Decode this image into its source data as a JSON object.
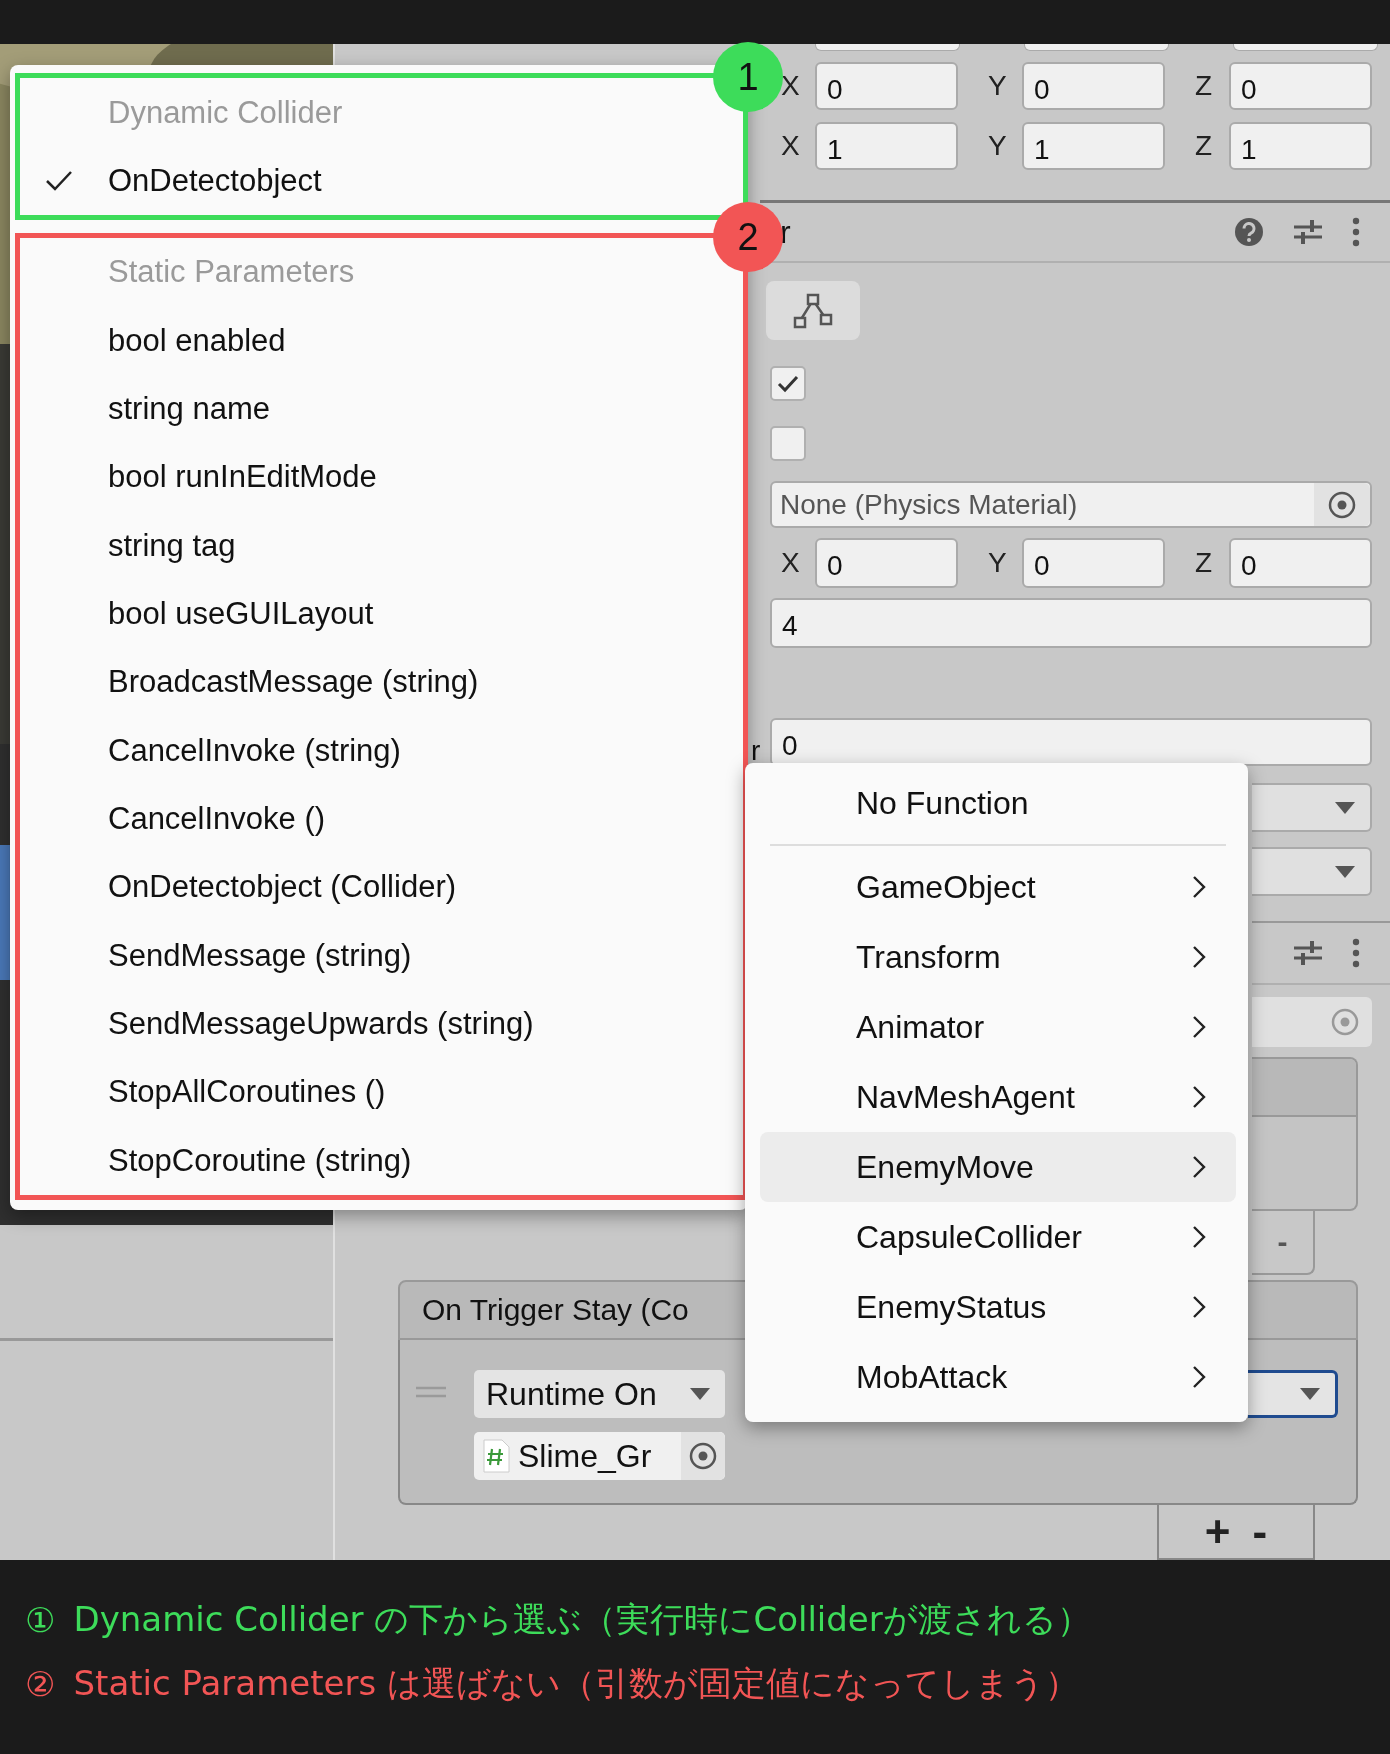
{
  "transform_rows": [
    {
      "fields": [
        {
          "axis": "X",
          "value": "0"
        },
        {
          "axis": "Y",
          "value": "0"
        },
        {
          "axis": "Z",
          "value": "0"
        }
      ]
    },
    {
      "fields": [
        {
          "axis": "X",
          "value": "1"
        },
        {
          "axis": "Y",
          "value": "1"
        },
        {
          "axis": "Z",
          "value": "1"
        }
      ]
    }
  ],
  "component": {
    "title": "r"
  },
  "toggles": [
    {
      "checked": true
    },
    {
      "checked": false
    }
  ],
  "material_field": {
    "value": "None (Physics Material)"
  },
  "center_row": {
    "fields": [
      {
        "axis": "X",
        "value": "0"
      },
      {
        "axis": "Y",
        "value": "0"
      },
      {
        "axis": "Z",
        "value": "0"
      }
    ]
  },
  "radius_field": {
    "value": "4"
  },
  "layer_field": {
    "label": "r",
    "value": "0"
  },
  "event_list": {
    "remove_button": "-"
  },
  "trigger_event": {
    "title": "On Trigger Stay (Co",
    "call_dropdown": "Runtime On",
    "target_field": "Slime_Gr",
    "add_button": "+",
    "remove_button": "-"
  },
  "function_menu": {
    "groups": [
      {
        "annotation": "1",
        "color": "#3ddc5a",
        "items": [
          {
            "kind": "header",
            "label": "Dynamic Collider"
          },
          {
            "kind": "option",
            "label": "OnDetectobject",
            "checked": true
          }
        ]
      },
      {
        "annotation": "2",
        "color": "#f25555",
        "items": [
          {
            "kind": "header",
            "label": "Static Parameters"
          },
          {
            "kind": "option",
            "label": "bool enabled",
            "checked": false
          },
          {
            "kind": "option",
            "label": "string name",
            "checked": false
          },
          {
            "kind": "option",
            "label": "bool runInEditMode",
            "checked": false
          },
          {
            "kind": "option",
            "label": "string tag",
            "checked": false
          },
          {
            "kind": "option",
            "label": "bool useGUILayout",
            "checked": false
          },
          {
            "kind": "option",
            "label": "BroadcastMessage (string)",
            "checked": false
          },
          {
            "kind": "option",
            "label": "CancelInvoke (string)",
            "checked": false
          },
          {
            "kind": "option",
            "label": "CancelInvoke ()",
            "checked": false
          },
          {
            "kind": "option",
            "label": "OnDetectobject (Collider)",
            "checked": false
          },
          {
            "kind": "option",
            "label": "SendMessage (string)",
            "checked": false
          },
          {
            "kind": "option",
            "label": "SendMessageUpwards (string)",
            "checked": false
          },
          {
            "kind": "option",
            "label": "StopAllCoroutines ()",
            "checked": false
          },
          {
            "kind": "option",
            "label": "StopCoroutine (string)",
            "checked": false
          }
        ]
      }
    ]
  },
  "component_menu": {
    "items": [
      {
        "kind": "option",
        "label": "No Function",
        "selected": false
      },
      {
        "kind": "separator"
      },
      {
        "kind": "submenu",
        "label": "GameObject",
        "selected": false
      },
      {
        "kind": "submenu",
        "label": "Transform",
        "selected": false
      },
      {
        "kind": "submenu",
        "label": "Animator",
        "selected": false
      },
      {
        "kind": "submenu",
        "label": "NavMeshAgent",
        "selected": false
      },
      {
        "kind": "submenu",
        "label": "EnemyMove",
        "selected": true
      },
      {
        "kind": "submenu",
        "label": "CapsuleCollider",
        "selected": false
      },
      {
        "kind": "submenu",
        "label": "EnemyStatus",
        "selected": false
      },
      {
        "kind": "submenu",
        "label": "MobAttack",
        "selected": false
      }
    ]
  },
  "captions": [
    {
      "marker": "①",
      "text": "Dynamic Collider の下から選ぶ（実行時にColliderが渡される）",
      "color": "#3ddc5a"
    },
    {
      "marker": "②",
      "text": "Static Parameters は選ばない（引数が固定値になってしまう）",
      "color": "#f25555"
    }
  ]
}
